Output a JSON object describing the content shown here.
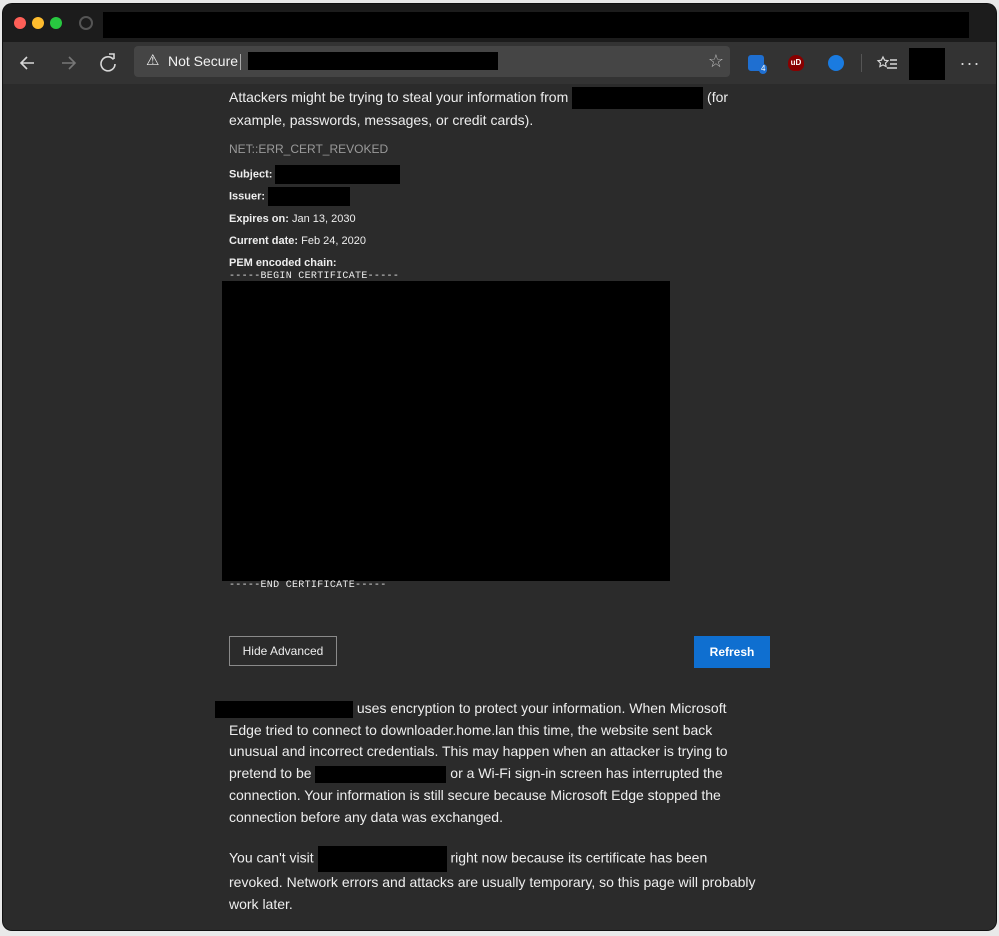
{
  "browser": {
    "address_bar": {
      "security_label": "Not Secure",
      "warning_icon": "warning-triangle-icon"
    },
    "toolbar_icons": [
      "back-arrow-icon",
      "forward-arrow-icon",
      "reload-icon",
      "favorite-star-icon",
      "bitwarden-extension-icon",
      "ublock-extension-icon",
      "blue-extension-icon",
      "favorites-list-icon",
      "more-menu-icon"
    ],
    "extensions": {
      "bitwarden_badge": "4",
      "ublock_text": "uD"
    },
    "menu_label": "···"
  },
  "page": {
    "warning_intro_before": "Attackers might be trying to steal your information from",
    "warning_intro_after": "(for example, passwords, messages, or credit cards).",
    "error_code": "NET::ERR_CERT_REVOKED",
    "cert": {
      "subject_label": "Subject:",
      "issuer_label": "Issuer:",
      "expires_label": "Expires on:",
      "expires_value": "Jan 13, 2030",
      "current_label": "Current date:",
      "current_value": "Feb 24, 2020",
      "pem_label": "PEM encoded chain:",
      "pem_begin": "-----BEGIN CERTIFICATE-----",
      "pem_end": "-----END CERTIFICATE-----"
    },
    "buttons": {
      "hide_advanced": "Hide Advanced",
      "refresh": "Refresh"
    },
    "explanation_part1": "uses encryption to protect your information. When Microsoft Edge tried to connect to downloader.home.lan this time, the website sent back unusual and incorrect credentials. This may happen when an attacker is trying to pretend to be",
    "explanation_part2": "or a Wi-Fi sign-in screen has interrupted the connection. Your information is still secure because Microsoft Edge stopped the connection before any data was exchanged.",
    "revoked_before": "You can't visit",
    "revoked_after": "right now because its certificate has been revoked. Network errors and attacks are usually temporary, so this page will probably work later."
  },
  "colors": {
    "accent": "#0f6fd0",
    "background": "#2b2b2b"
  }
}
